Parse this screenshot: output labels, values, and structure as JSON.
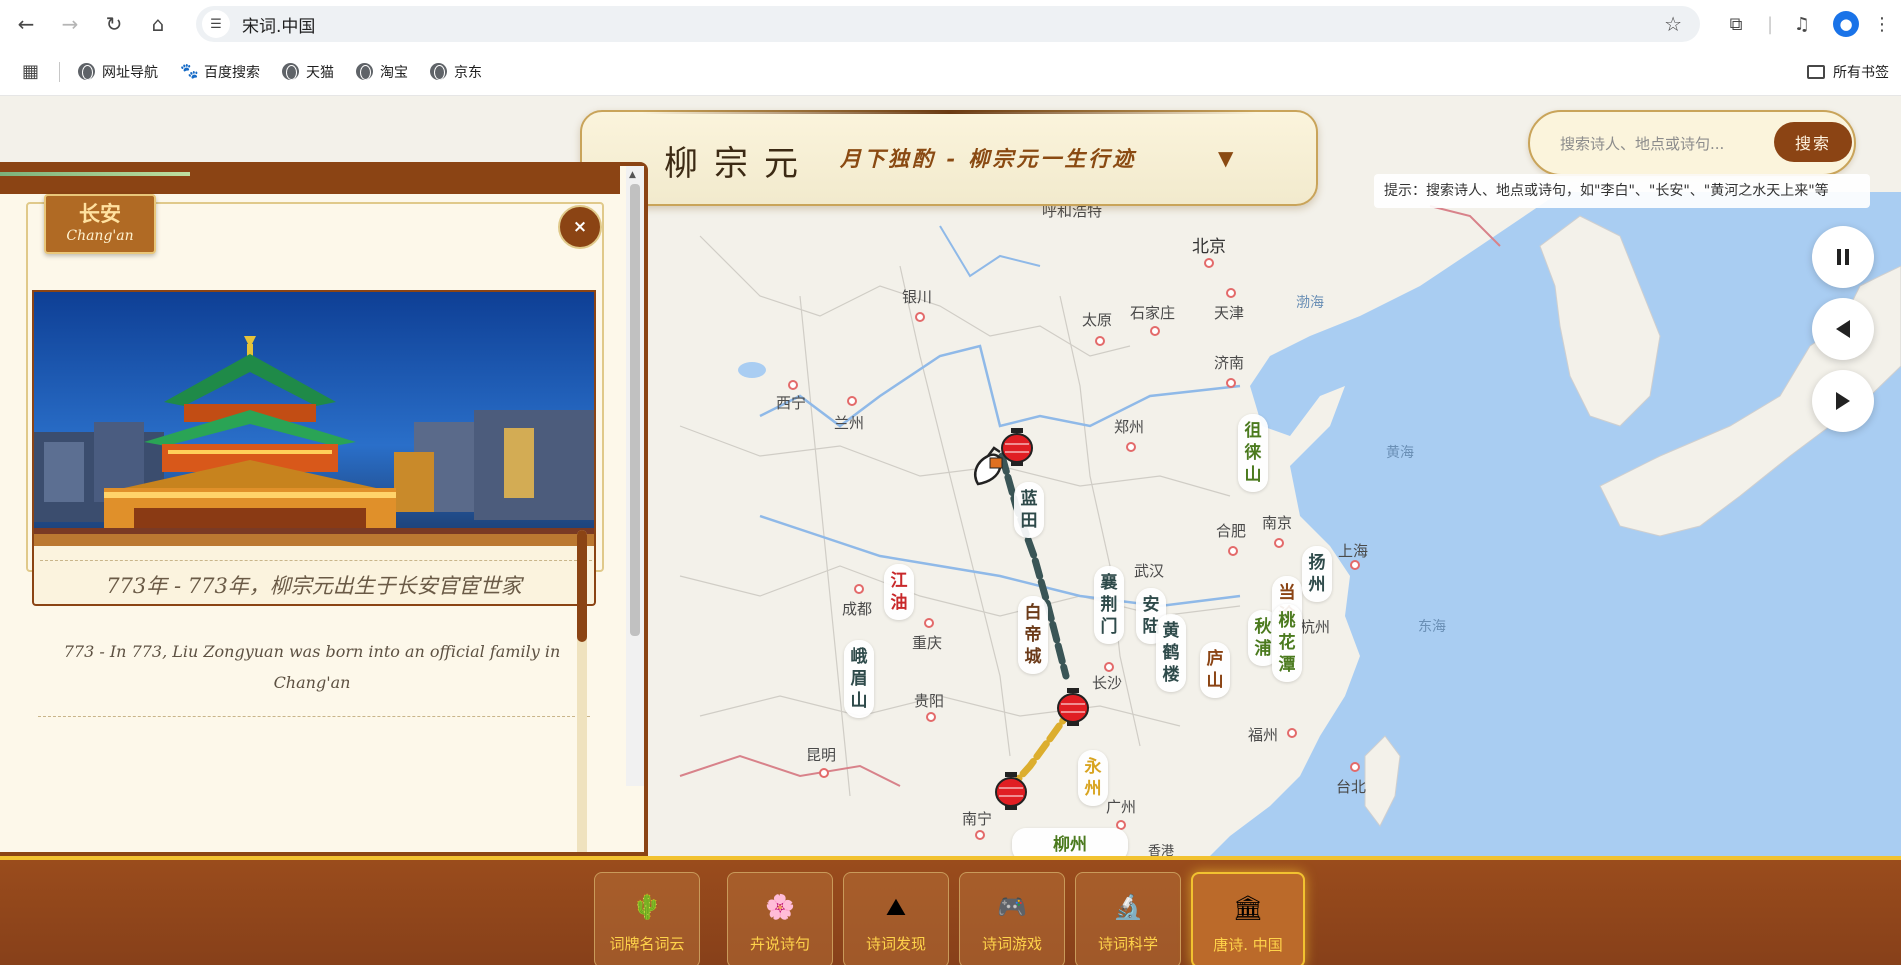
{
  "browser": {
    "url": "宋词.中国",
    "bookmarks": [
      {
        "label": "网址导航",
        "icon": "globe-icon"
      },
      {
        "label": "百度搜索",
        "icon": "baidu-paw-icon"
      },
      {
        "label": "天猫",
        "icon": "globe-icon"
      },
      {
        "label": "淘宝",
        "icon": "globe-icon"
      },
      {
        "label": "京东",
        "icon": "globe-icon"
      }
    ],
    "all_bookmarks": "所有书签"
  },
  "header": {
    "poet": "柳宗元",
    "poem_title": "月下独酌 - 柳宗元一生行迹",
    "dropdown_icon": "▼"
  },
  "search": {
    "placeholder": "搜索诗人、地点或诗句...",
    "button": "搜索",
    "hint": "提示：搜索诗人、地点或诗句，如\"李白\"、\"长安\"、\"黄河之水天上来\"等"
  },
  "playback": {
    "pause_icon": "pause-icon",
    "prev_icon": "prev-icon",
    "next_icon": "next-icon"
  },
  "panel": {
    "place_zh": "长安",
    "place_en": "Chang'an",
    "close": "×",
    "event_zh": "773年 - 773年，柳宗元出生于长安官宦世家",
    "event_en": "773 - In 773, Liu Zongyuan was born into an official family in Chang'an"
  },
  "map": {
    "cities": [
      "呼和浩特",
      "北京",
      "银川",
      "太原",
      "石家庄",
      "天津",
      "渤海",
      "西宁",
      "兰州",
      "济南",
      "郑州",
      "合肥",
      "南京",
      "上海",
      "武汉",
      "成都",
      "重庆",
      "长沙",
      "杭州",
      "贵阳",
      "福州",
      "昆明",
      "南宁",
      "广州",
      "台北",
      "香港"
    ],
    "seas": [
      "渤海",
      "黄海",
      "东海"
    ],
    "pois": [
      {
        "name": "蓝田",
        "color": "#2e4a4a"
      },
      {
        "name": "江油",
        "color": "#c8282a"
      },
      {
        "name": "白帝城",
        "color": "#6b3a18"
      },
      {
        "name": "襄荆门",
        "color": "#2e4a4a"
      },
      {
        "name": "安陆",
        "color": "#2e4a4a"
      },
      {
        "name": "黄鹤楼",
        "color": "#2e4a4a"
      },
      {
        "name": "庐山",
        "color": "#8b4414"
      },
      {
        "name": "秋浦",
        "color": "#4b7a1e"
      },
      {
        "name": "当涂",
        "color": "#8b4414"
      },
      {
        "name": "桃花潭",
        "color": "#4b7a1e"
      },
      {
        "name": "扬州",
        "color": "#2e4a4a"
      },
      {
        "name": "徂徕山",
        "color": "#4b7a1e"
      },
      {
        "name": "峨眉山",
        "color": "#2e4a4a"
      },
      {
        "name": "永州",
        "color": "#d8a420"
      },
      {
        "name": "柳州",
        "color": "#4b7a1e"
      }
    ]
  },
  "bottom_nav": [
    {
      "label": "词牌名词云",
      "icon": "🌵",
      "icon_name": "cactus-icon",
      "active": false
    },
    {
      "label": "卉说诗句",
      "icon": "🌸",
      "icon_name": "blossom-icon",
      "active": false
    },
    {
      "label": "诗词发现",
      "icon": "⛰",
      "icon_name": "mountain-icon",
      "active": false
    },
    {
      "label": "诗词游戏",
      "icon": "🎮",
      "icon_name": "gamepad-icon",
      "active": false
    },
    {
      "label": "诗词科学",
      "icon": "🔬",
      "icon_name": "microscope-icon",
      "active": false
    },
    {
      "label": "唐诗. 中国",
      "icon": "🏛",
      "icon_name": "classical-building-icon",
      "active": true
    }
  ],
  "colors": {
    "brand_brown": "#8b4414",
    "gold": "#f2c230",
    "cream": "#fbf4dc"
  }
}
